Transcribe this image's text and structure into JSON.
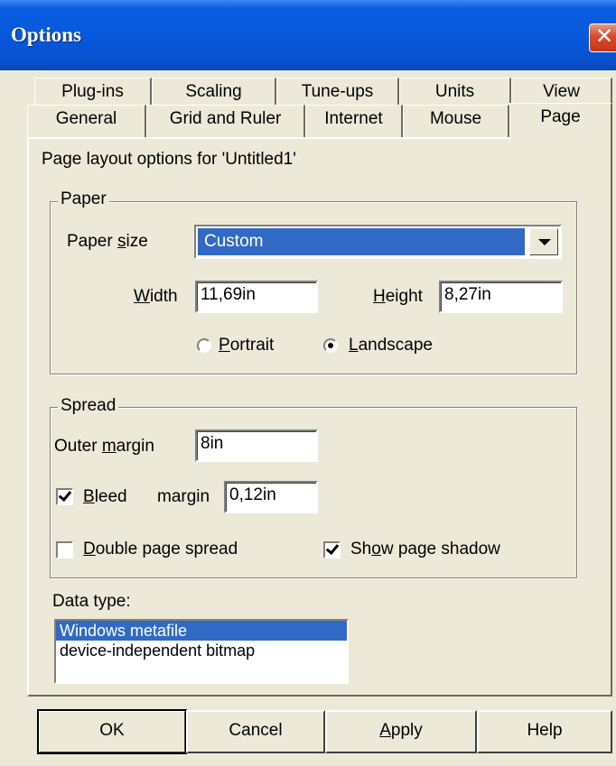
{
  "window": {
    "title": "Options",
    "close_glyph": "✕"
  },
  "tabs": {
    "row1": [
      "Plug-ins",
      "Scaling",
      "Tune-ups",
      "Units",
      "View"
    ],
    "row2": [
      "General",
      "Grid and Ruler",
      "Internet",
      "Mouse",
      "Page"
    ],
    "active": "Page"
  },
  "page": {
    "header": "Page layout options for 'Untitled1'",
    "paper": {
      "legend": "Paper",
      "size_label_pre": "Paper ",
      "size_label_key": "s",
      "size_label_post": "ize",
      "size_value": "Custom",
      "width_label_key": "W",
      "width_label_post": "idth",
      "width_value": "11,69in",
      "height_label_key": "H",
      "height_label_post": "eight",
      "height_value": "8,27in",
      "portrait_key": "P",
      "portrait_post": "ortrait",
      "landscape_key": "L",
      "landscape_post": "andscape",
      "orientation_selected": "Landscape"
    },
    "spread": {
      "legend": "Spread",
      "outer_margin_pre": "Outer ",
      "outer_margin_key": "m",
      "outer_margin_post": "argin",
      "outer_margin_value": "8in",
      "bleed_key": "B",
      "bleed_post": "leed",
      "bleed_margin_label": "margin",
      "bleed_checked": true,
      "bleed_margin_value": "0,12in",
      "double_key": "D",
      "double_post": "ouble page spread",
      "double_checked": false,
      "shadow_pre": "Sh",
      "shadow_key": "o",
      "shadow_post": "w page shadow",
      "shadow_checked": true
    },
    "data_type": {
      "label": "Data type:",
      "options": [
        "Windows metafile",
        "device-independent bitmap"
      ],
      "selected": "Windows metafile"
    }
  },
  "buttons": {
    "ok": "OK",
    "cancel": "Cancel",
    "apply_key": "A",
    "apply_post": "pply",
    "help": "Help"
  },
  "colors": {
    "title_bar": "#0858dd",
    "selection": "#316ac5",
    "dialog_bg": "#ece9d8",
    "close_button": "#d8482a"
  }
}
